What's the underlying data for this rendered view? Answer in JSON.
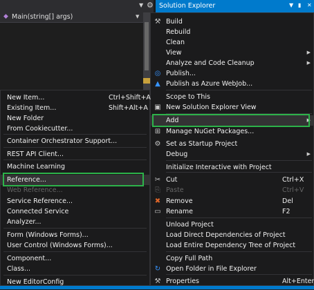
{
  "editor": {
    "member_dropdown": "Main(string[] args)"
  },
  "solution_explorer": {
    "title": "Solution Explorer"
  },
  "project_menu": {
    "items": [
      {
        "label": "Build",
        "icon": "build-icon",
        "glyph": "⚒",
        "color": "#c5c5c5"
      },
      {
        "label": "Rebuild",
        "icon": "",
        "glyph": ""
      },
      {
        "label": "Clean",
        "icon": "",
        "glyph": ""
      },
      {
        "label": "View",
        "icon": "",
        "glyph": "",
        "submenu": true
      },
      {
        "label": "Analyze and Code Cleanup",
        "icon": "",
        "glyph": "",
        "submenu": true
      },
      {
        "label": "Publish...",
        "icon": "globe-icon",
        "glyph": "◎",
        "color": "#3794ff"
      },
      {
        "label": "Publish as Azure WebJob...",
        "icon": "azure-icon",
        "glyph": "▲",
        "color": "#3794ff"
      },
      {
        "label": "Scope to This",
        "icon": "",
        "glyph": ""
      },
      {
        "label": "New Solution Explorer View",
        "icon": "window-icon",
        "glyph": "▣",
        "color": "#c5c5c5"
      },
      {
        "label": "Add",
        "icon": "",
        "glyph": "",
        "submenu": true,
        "highlighted": true
      },
      {
        "label": "Manage NuGet Packages...",
        "icon": "nuget-icon",
        "glyph": "⊞",
        "color": "#c5c5c5"
      },
      {
        "label": "Set as Startup Project",
        "icon": "gear-icon",
        "glyph": "⚙",
        "color": "#c5c5c5"
      },
      {
        "label": "Debug",
        "icon": "",
        "glyph": "",
        "submenu": true
      },
      {
        "label": "Initialize Interactive with Project",
        "icon": "",
        "glyph": ""
      },
      {
        "label": "Cut",
        "icon": "scissors-icon",
        "glyph": "✂",
        "color": "#c5c5c5",
        "shortcut": "Ctrl+X"
      },
      {
        "label": "Paste",
        "icon": "paste-icon",
        "glyph": "⎘",
        "color": "#656565",
        "shortcut": "Ctrl+V",
        "disabled": true
      },
      {
        "label": "Remove",
        "icon": "remove-icon",
        "glyph": "✖",
        "color": "#e2672a",
        "shortcut": "Del"
      },
      {
        "label": "Rename",
        "icon": "rename-icon",
        "glyph": "▭",
        "color": "#c5c5c5",
        "shortcut": "F2"
      },
      {
        "label": "Unload Project",
        "icon": "",
        "glyph": ""
      },
      {
        "label": "Load Direct Dependencies of Project",
        "icon": "",
        "glyph": ""
      },
      {
        "label": "Load Entire Dependency Tree of Project",
        "icon": "",
        "glyph": ""
      },
      {
        "label": "Copy Full Path",
        "icon": "",
        "glyph": ""
      },
      {
        "label": "Open Folder in File Explorer",
        "icon": "refresh-icon",
        "glyph": "↻",
        "color": "#3794ff"
      },
      {
        "label": "Properties",
        "icon": "wrench-icon",
        "glyph": "⚒",
        "color": "#c5c5c5",
        "shortcut": "Alt+Enter"
      }
    ]
  },
  "add_menu": {
    "items": [
      {
        "label": "New Item...",
        "shortcut": "Ctrl+Shift+A"
      },
      {
        "label": "Existing Item...",
        "shortcut": "Shift+Alt+A"
      },
      {
        "label": "New Folder",
        "shortcut": ""
      },
      {
        "label": "From Cookiecutter...",
        "shortcut": ""
      },
      {
        "label": "Container Orchestrator Support...",
        "shortcut": ""
      },
      {
        "label": "REST API Client...",
        "shortcut": ""
      },
      {
        "label": "Machine Learning",
        "shortcut": ""
      },
      {
        "label": "Reference...",
        "shortcut": "",
        "highlighted": true
      },
      {
        "label": "Web Reference...",
        "shortcut": "",
        "disabled": true
      },
      {
        "label": "Service Reference...",
        "shortcut": ""
      },
      {
        "label": "Connected Service",
        "shortcut": ""
      },
      {
        "label": "Analyzer...",
        "shortcut": ""
      },
      {
        "label": "Form (Windows Forms)...",
        "shortcut": ""
      },
      {
        "label": "User Control (Windows Forms)...",
        "shortcut": ""
      },
      {
        "label": "Component...",
        "shortcut": ""
      },
      {
        "label": "Class...",
        "shortcut": ""
      },
      {
        "label": "New EditorConfig",
        "shortcut": ""
      }
    ]
  }
}
